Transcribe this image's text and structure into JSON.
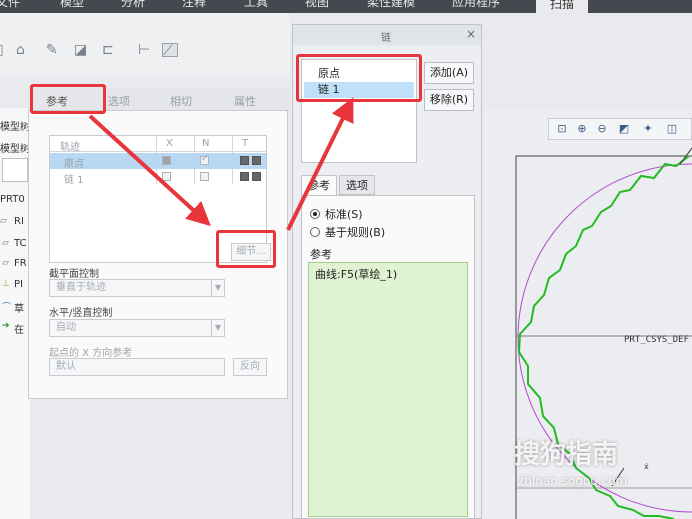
{
  "ribbon": {
    "tabs": [
      "文件",
      "模型",
      "分析",
      "注释",
      "工具",
      "视图",
      "柔性建模",
      "应用程序",
      "扫描"
    ],
    "active_tab": "扫描"
  },
  "tree": {
    "items": [
      "模型树",
      "模型树",
      "PRT0",
      "RI",
      "TC",
      "FR",
      "PI",
      "草",
      "在"
    ]
  },
  "ref_tabs": [
    "参考",
    "选项",
    "相切",
    "属性"
  ],
  "ref_panel": {
    "grid_headers": [
      "轨迹",
      "X",
      "N",
      "T"
    ],
    "rows": [
      {
        "label": "原点",
        "selected": true
      },
      {
        "label": "链 1",
        "selected": false
      }
    ],
    "detail_button": "细节...",
    "section_plane_label": "截平面控制",
    "section_plane_value": "垂直于轨迹",
    "hv_label": "水平/竖直控制",
    "hv_value": "自动",
    "x_ref_label": "起点的 X 方向参考",
    "x_ref_value": "默认",
    "reverse_button": "反向"
  },
  "chain_dialog": {
    "title": "链",
    "close": "×",
    "list": [
      "原点",
      "链 1"
    ],
    "selected_index": 1,
    "add_button": "添加(A)",
    "remove_button": "移除(R)",
    "tabs": [
      "参考",
      "选项"
    ],
    "radio_standard": "标准(S)",
    "radio_rule": "基于规则(B)",
    "section_label": "参考",
    "curve_ref": "曲线:F5(草绘_1)"
  },
  "graphics": {
    "csys_label": "PRT_CSYS_DEF"
  },
  "watermark": {
    "brand": "搜狗指南",
    "url": "zhinan.sogou.com"
  },
  "colors": {
    "highlight": "#e8353b",
    "curve": "#22bb22",
    "circle": "#b04ad0",
    "selection": "#b7d7f2"
  }
}
